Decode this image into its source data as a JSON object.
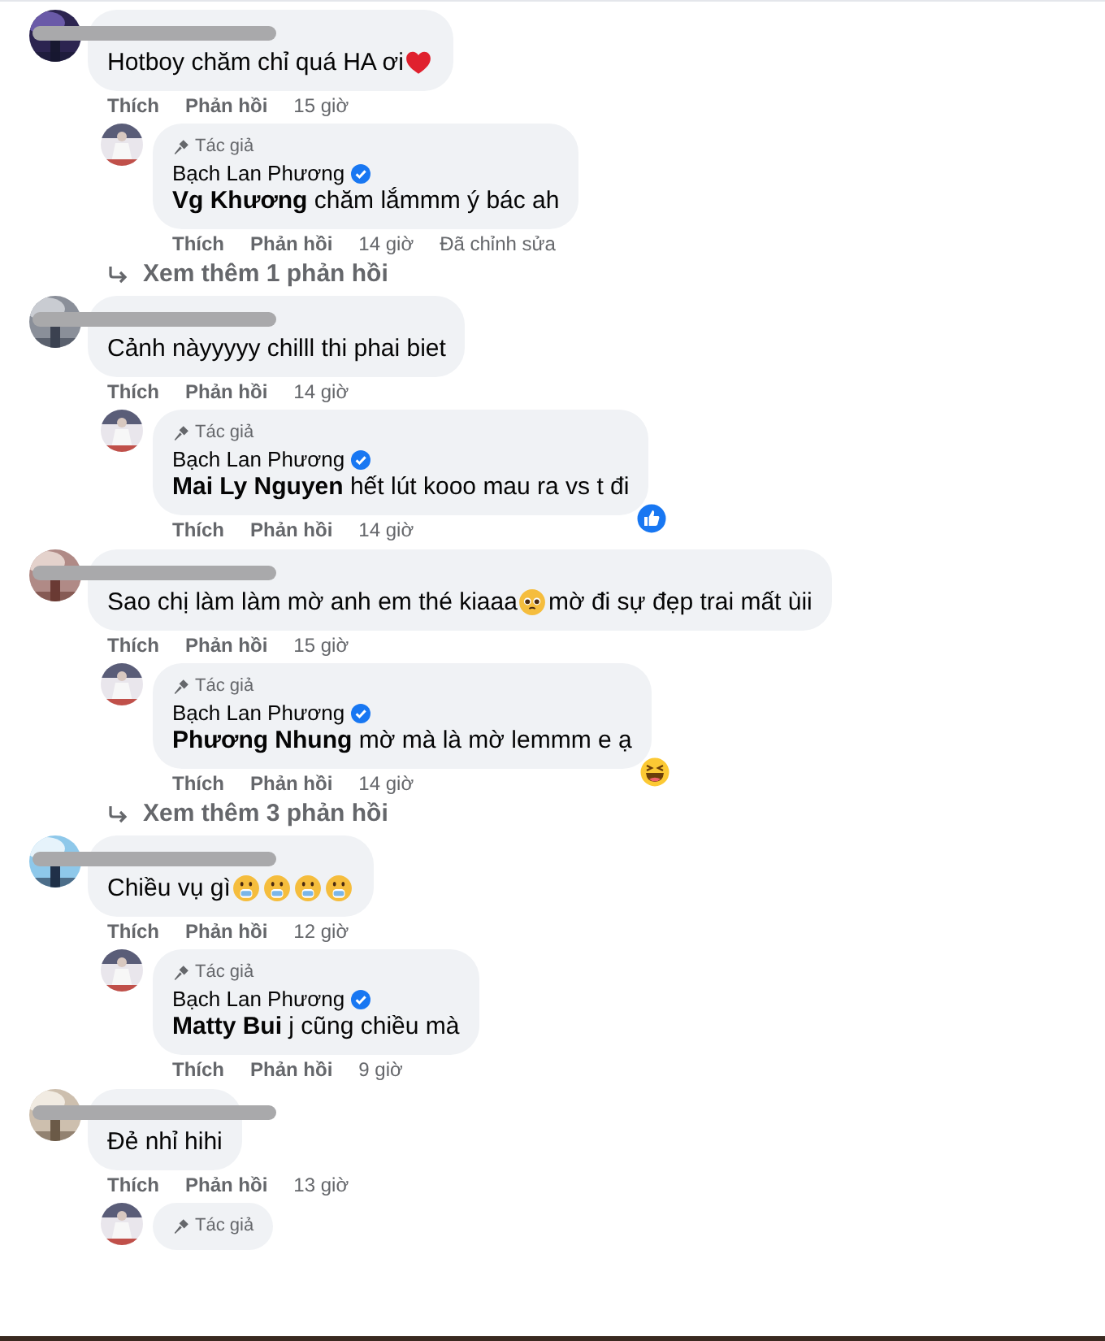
{
  "threads": [
    {
      "comment": {
        "name_redacted": true,
        "parts": [
          {
            "kind": "text",
            "text": "Hotboy chăm chỉ quá HA ơi "
          },
          {
            "kind": "heart"
          }
        ],
        "like": "Thích",
        "reply": "Phản hồi",
        "time": "15 giờ"
      },
      "replies": [
        {
          "badge": "Tác giả",
          "name": "Bạch Lan Phương",
          "verified": true,
          "mention": "Vg Khương",
          "text": " chăm lắmmm ý bác ah",
          "like": "Thích",
          "reply": "Phản hồi",
          "time": "14 giờ",
          "edited": "Đã chỉnh sửa"
        }
      ],
      "more_replies": "Xem thêm 1 phản hồi"
    },
    {
      "comment": {
        "name_redacted": true,
        "parts": [
          {
            "kind": "text",
            "text": "Cảnh nàyyyyy chilll thi phai biet"
          }
        ],
        "like": "Thích",
        "reply": "Phản hồi",
        "time": "14 giờ"
      },
      "replies": [
        {
          "badge": "Tác giả",
          "name": "Bạch Lan Phương",
          "verified": true,
          "mention": "Mai Ly Nguyen",
          "text": " hết lút kooo mau ra vs t đi",
          "like": "Thích",
          "reply": "Phản hồi",
          "time": "14 giờ",
          "reaction": {
            "kind": "like"
          }
        }
      ]
    },
    {
      "comment": {
        "name_redacted": true,
        "parts": [
          {
            "kind": "text",
            "text": "Sao chị làm làm mờ anh em thé kiaaa"
          },
          {
            "kind": "pleading"
          },
          {
            "kind": "text",
            "text": " mờ đi sự đẹp trai mất ùii"
          }
        ],
        "like": "Thích",
        "reply": "Phản hồi",
        "time": "15 giờ"
      },
      "replies": [
        {
          "badge": "Tác giả",
          "name": "Bạch Lan Phương",
          "verified": true,
          "mention": "Phương Nhung",
          "text": " mờ mà là mờ lemmm e ạ",
          "like": "Thích",
          "reply": "Phản hồi",
          "time": "14 giờ",
          "reaction": {
            "kind": "haha"
          }
        }
      ],
      "more_replies": "Xem thêm 3 phản hồi"
    },
    {
      "comment": {
        "name_redacted": true,
        "parts": [
          {
            "kind": "text",
            "text": "Chiều vụ gì "
          },
          {
            "kind": "hand-over-mouth"
          },
          {
            "kind": "hand-over-mouth"
          },
          {
            "kind": "hand-over-mouth"
          },
          {
            "kind": "hand-over-mouth"
          }
        ],
        "like": "Thích",
        "reply": "Phản hồi",
        "time": "12 giờ"
      },
      "replies": [
        {
          "badge": "Tác giả",
          "name": "Bạch Lan Phương",
          "verified": true,
          "mention": "Matty Bui",
          "text": " j cũng chiều mà",
          "like": "Thích",
          "reply": "Phản hồi",
          "time": "9 giờ"
        }
      ]
    },
    {
      "comment": {
        "name_redacted": true,
        "parts": [
          {
            "kind": "text",
            "text": "Đẻ nhỉ hihi"
          }
        ],
        "like": "Thích",
        "reply": "Phản hồi",
        "time": "13 giờ"
      },
      "replies": [
        {
          "badge": "Tác giả"
        }
      ]
    }
  ]
}
